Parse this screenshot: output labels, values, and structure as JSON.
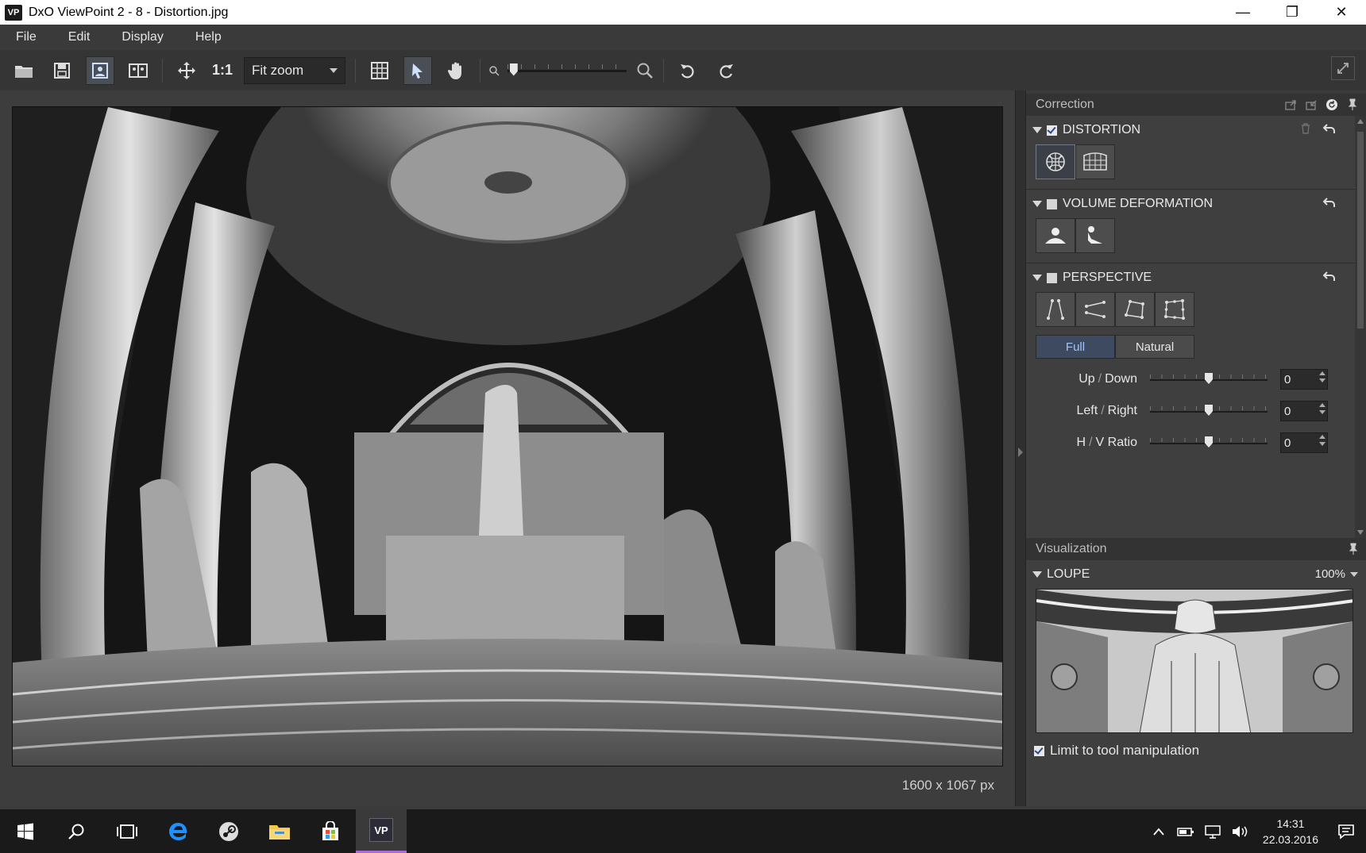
{
  "window": {
    "app_badge": "VP",
    "title": "DxO ViewPoint 2 - 8 - Distortion.jpg",
    "minimize": "—",
    "restore": "❐",
    "close": "✕"
  },
  "menu": [
    "File",
    "Edit",
    "Display",
    "Help"
  ],
  "toolbar": {
    "one_to_one": "1:1",
    "zoom_select": "Fit zoom",
    "zoom_slider_fraction": 0.02
  },
  "canvas": {
    "image_size": "1600 x 1067 px"
  },
  "correction_panel": {
    "title": "Correction",
    "sections": {
      "distortion": {
        "label": "DISTORTION",
        "checked": true
      },
      "volume": {
        "label": "VOLUME DEFORMATION",
        "checked": false
      },
      "perspective": {
        "label": "PERSPECTIVE",
        "checked": false,
        "mode_full": "Full",
        "mode_natural": "Natural",
        "sliders": [
          {
            "a": "Up",
            "b": "Down",
            "value": "0",
            "fraction": 0.5
          },
          {
            "a": "Left",
            "b": "Right",
            "value": "0",
            "fraction": 0.5
          },
          {
            "a": "H",
            "b": "V Ratio",
            "value": "0",
            "fraction": 0.5
          }
        ]
      }
    }
  },
  "visualization_panel": {
    "title": "Visualization",
    "loupe_label": "LOUPE",
    "loupe_zoom": "100%",
    "limit_label": "Limit to tool manipulation",
    "limit_checked": true
  },
  "taskbar": {
    "time": "14:31",
    "date": "22.03.2016",
    "vp_badge": "VP"
  },
  "colors": {
    "accent_blue": "#3d4a60",
    "taskbar_active": "#a86bd8"
  }
}
